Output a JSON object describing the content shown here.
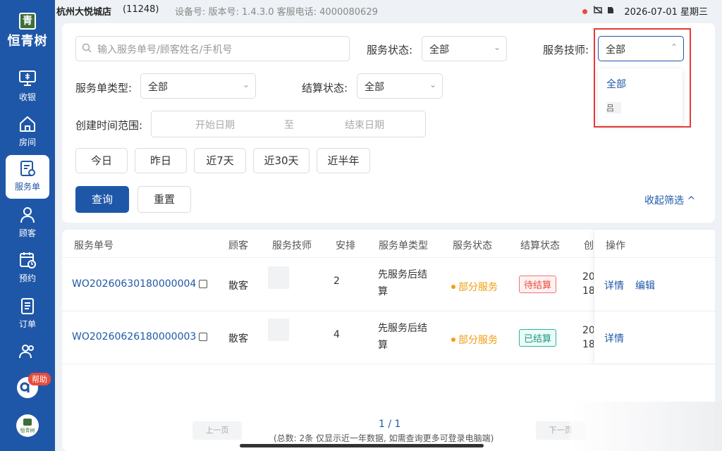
{
  "sidebar": {
    "logo_text": "恒青树",
    "logo_mark": "青",
    "items": [
      {
        "label": "收银"
      },
      {
        "label": "房间"
      },
      {
        "label": "服务单"
      },
      {
        "label": "顾客"
      },
      {
        "label": "预约"
      },
      {
        "label": "订单"
      },
      {
        "label": ""
      }
    ],
    "help_badge": "帮助",
    "brand_small": "恒青树"
  },
  "statusbar": {
    "store": "杭州大悦城店",
    "store_id": "(11248)",
    "device": "设备号: 版本号: 1.4.3.0  客服电话: 4000080629",
    "datetime": "2026-07-01 星期三"
  },
  "filters": {
    "search_placeholder": "输入服务单号/顾客姓名/手机号",
    "service_status_label": "服务状态:",
    "service_status_value": "全部",
    "technician_label": "服务技师:",
    "technician_value": "全部",
    "order_type_label": "服务单类型:",
    "order_type_value": "全部",
    "settle_status_label": "结算状态:",
    "settle_status_value": "全部",
    "time_range_label": "创建时间范围:",
    "start_date_placeholder": "开始日期",
    "to_label": "至",
    "end_date_placeholder": "结束日期",
    "quick_ranges": [
      "今日",
      "昨日",
      "近7天",
      "近30天",
      "近半年"
    ],
    "query_label": "查询",
    "reset_label": "重置",
    "collapse_label": "收起筛选 ^"
  },
  "dropdown": {
    "options": [
      "全部",
      "吕"
    ]
  },
  "table": {
    "headers": [
      "服务单号",
      "顾客",
      "服务技师",
      "安排",
      "服务单类型",
      "服务状态",
      "结算状态",
      "创",
      "操作"
    ],
    "rows": [
      {
        "order_no": "WO20260630180000004",
        "customer": "散客",
        "arrangement": "2",
        "type_line1": "先服务后结",
        "type_line2": "算",
        "service_status": "部分服务",
        "settle_status": "待结算",
        "created_1": "20",
        "created_2": "18",
        "actions": [
          "详情",
          "编辑"
        ]
      },
      {
        "order_no": "WO20260626180000003",
        "customer": "散客",
        "arrangement": "4",
        "type_line1": "先服务后结",
        "type_line2": "算",
        "service_status": "部分服务",
        "settle_status": "已结算",
        "created_1": "20",
        "created_2": "18",
        "actions": [
          "详情"
        ]
      }
    ]
  },
  "pagination": {
    "prev": "上一页",
    "next": "下一页",
    "page": "1 / 1",
    "note": "(总数: 2条 仅显示近一年数据, 如需查询更多可登录电脑端)"
  },
  "colors": {
    "primary": "#1f57a8",
    "pending": "#e74c3c",
    "settled": "#1a9a82",
    "partial": "#f39c12",
    "highlight_frame": "#e53935"
  }
}
